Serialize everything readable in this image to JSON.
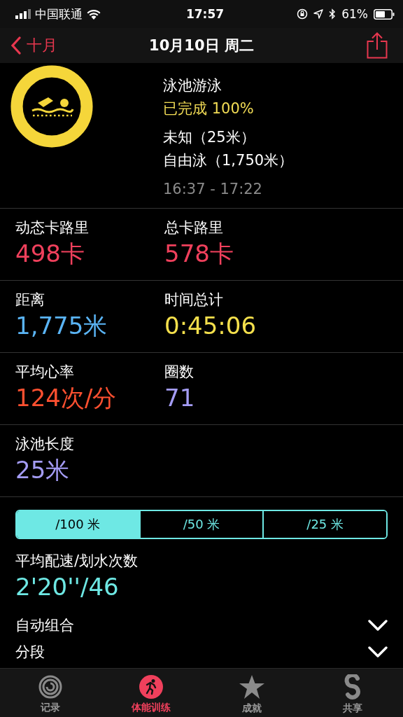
{
  "status_bar": {
    "carrier": "中国联通",
    "time": "17:57",
    "battery": "61%"
  },
  "nav": {
    "back_label": "十月",
    "title": "10月10日 周二"
  },
  "workout": {
    "name": "泳池游泳",
    "completion": "已完成 100%",
    "level": 1,
    "details": [
      "未知（25米）",
      "自由泳（1,750米）"
    ],
    "time_range": "16:37 - 17:22"
  },
  "metrics": [
    [
      {
        "label": "动态卡路里",
        "value": "498卡",
        "color": "#f0405c"
      },
      {
        "label": "总卡路里",
        "value": "578卡",
        "color": "#f0405c"
      }
    ],
    [
      {
        "label": "距离",
        "value": "1,775米",
        "color": "#5ab4f5"
      },
      {
        "label": "时间总计",
        "value": "0:45:06",
        "color": "#f5e04c"
      }
    ],
    [
      {
        "label": "平均心率",
        "value": "124次/分",
        "color": "#ff5030"
      },
      {
        "label": "圈数",
        "value": "71",
        "color": "#a49cf5"
      }
    ],
    [
      {
        "label": "泳池长度",
        "value": "25米",
        "color": "#a49cf5"
      }
    ]
  ],
  "pace_units": [
    {
      "label": "/100 米",
      "selected": true
    },
    {
      "label": "/50 米",
      "selected": false
    },
    {
      "label": "/25 米",
      "selected": false
    }
  ],
  "pace": {
    "label": "平均配速/划水次数",
    "value": "2'20''/46"
  },
  "sections": [
    {
      "label": "自动组合",
      "expanded": false
    },
    {
      "label": "分段",
      "expanded": false
    }
  ],
  "tabs": [
    {
      "kind": "activity",
      "label": "记录",
      "selected": false
    },
    {
      "kind": "workouts",
      "label": "体能训练",
      "selected": true
    },
    {
      "kind": "awards",
      "label": "成就",
      "selected": false
    },
    {
      "kind": "sharing",
      "label": "共享",
      "selected": false
    }
  ]
}
